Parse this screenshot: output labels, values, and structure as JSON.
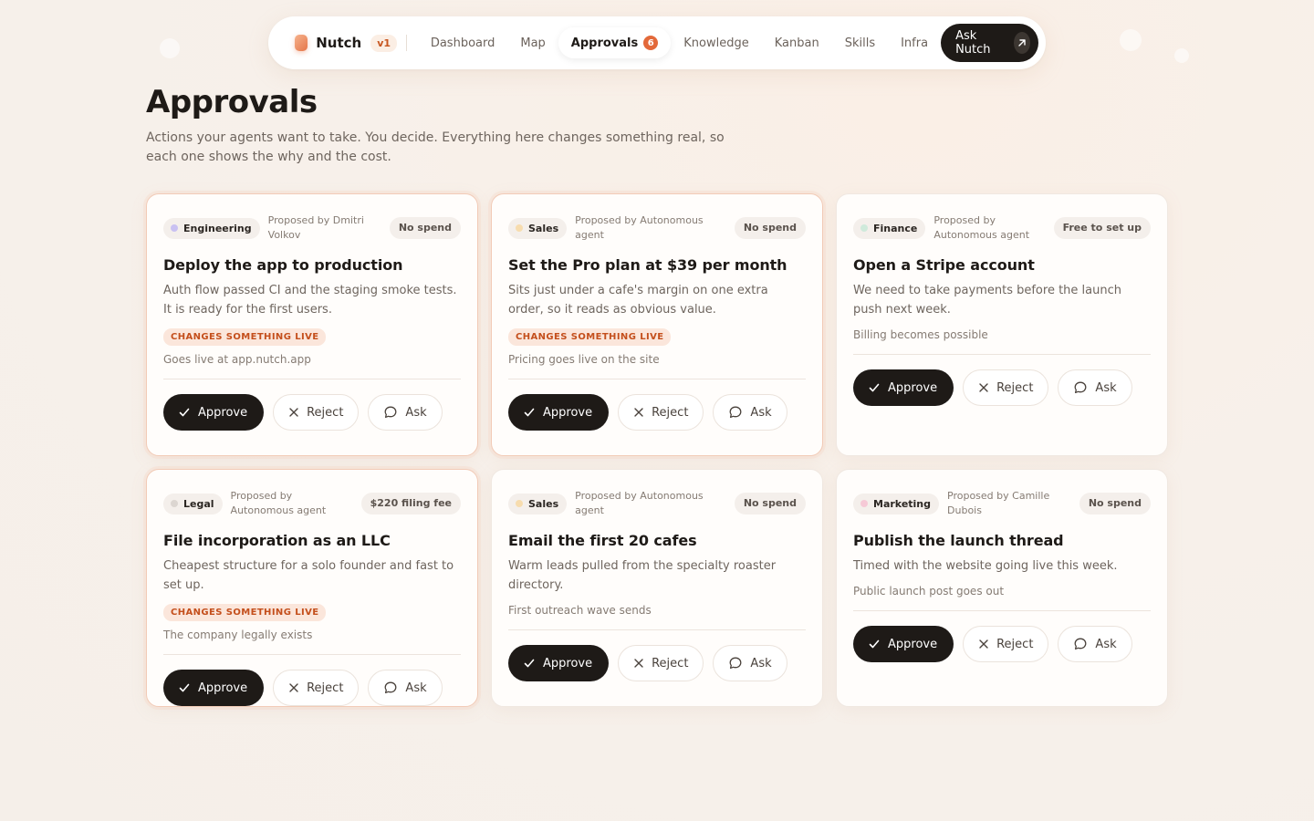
{
  "nav": {
    "brand": "Nutch",
    "version": "v1",
    "items": [
      "Dashboard",
      "Map",
      "Approvals",
      "Knowledge",
      "Kanban",
      "Skills",
      "Infra"
    ],
    "active_index": 2,
    "approvals_count": "6",
    "cta": "Ask Nutch"
  },
  "header": {
    "title": "Approvals",
    "subtitle": "Actions your agents want to take. You decide. Everything here changes something real, so each one shows the why and the cost."
  },
  "labels": {
    "approve": "Approve",
    "reject": "Reject",
    "ask": "Ask",
    "live_badge": "CHANGES SOMETHING LIVE"
  },
  "colors": {
    "engineering": "#c9c1f2",
    "sales": "#f7dcae",
    "finance": "#cfeadb",
    "legal": "#dcd6d1",
    "marketing": "#f6c9d6",
    "accent": "#e3693a"
  },
  "cards": [
    {
      "tag": "Engineering",
      "proposed": "Proposed by Dmitri Volkov",
      "cost": "No spend",
      "title": "Deploy the app to production",
      "desc": "Auth flow passed CI and the staging smoke tests. It is ready for the first users.",
      "live": true,
      "effect": "Goes live at app.nutch.app"
    },
    {
      "tag": "Sales",
      "proposed": "Proposed by Autonomous agent",
      "cost": "No spend",
      "title": "Set the Pro plan at $39 per month",
      "desc": "Sits just under a cafe's margin on one extra order, so it reads as obvious value.",
      "live": true,
      "effect": "Pricing goes live on the site"
    },
    {
      "tag": "Finance",
      "proposed": "Proposed by Autonomous agent",
      "cost": "Free to set up",
      "title": "Open a Stripe account",
      "desc": "We need to take payments before the launch push next week.",
      "live": false,
      "effect": "Billing becomes possible"
    },
    {
      "tag": "Legal",
      "proposed": "Proposed by Autonomous agent",
      "cost": "$220 filing fee",
      "title": "File incorporation as an LLC",
      "desc": "Cheapest structure for a solo founder and fast to set up.",
      "live": true,
      "effect": "The company legally exists"
    },
    {
      "tag": "Sales",
      "proposed": "Proposed by Autonomous agent",
      "cost": "No spend",
      "title": "Email the first 20 cafes",
      "desc": "Warm leads pulled from the specialty roaster directory.",
      "live": false,
      "effect": "First outreach wave sends"
    },
    {
      "tag": "Marketing",
      "proposed": "Proposed by Camille Dubois",
      "cost": "No spend",
      "title": "Publish the launch thread",
      "desc": "Timed with the website going live this week.",
      "live": false,
      "effect": "Public launch post goes out"
    }
  ]
}
